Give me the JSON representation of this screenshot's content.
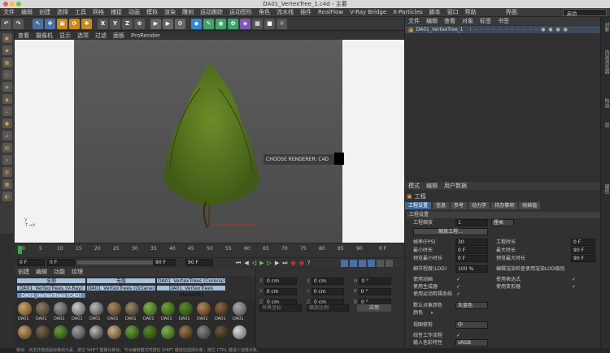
{
  "window": {
    "title": "DA01_VertexTree_1.c4d - 主要"
  },
  "menubar": {
    "items": [
      "文件",
      "编辑",
      "创建",
      "选择",
      "工具",
      "网格",
      "捕捉",
      "动画",
      "模拟",
      "渲染",
      "雕刻",
      "运动跟踪",
      "运动图形",
      "角色",
      "流水线",
      "插件",
      "RealFlow",
      "V-Ray Bridge",
      "X-Particles",
      "脚本",
      "窗口",
      "帮助"
    ],
    "layout_label": "界面:",
    "layout_value": "启动"
  },
  "viewport": {
    "menu": [
      "查看",
      "摄像机",
      "显示",
      "选项",
      "过滤",
      "面板",
      "ProRender"
    ],
    "overlay_text": "CHOOSE RENDERER: C4D"
  },
  "timeline": {
    "ticks": [
      "0",
      "5",
      "10",
      "15",
      "20",
      "25",
      "30",
      "35",
      "40",
      "45",
      "50",
      "55",
      "60",
      "65",
      "70",
      "75",
      "80",
      "85",
      "90"
    ],
    "end_frame": "0 F"
  },
  "transport": {
    "start": "0 F",
    "current": "0 F",
    "end": "90 F",
    "end2": "90 F"
  },
  "materials": {
    "menu": [
      "创建",
      "编辑",
      "功能",
      "纹理"
    ],
    "tags": [
      "全部",
      "无层",
      "DA01_VertexTrees (Corona)",
      "DA01_VertexTrees (V-Ray)",
      "DA01_VertexTrees (Octane)",
      "DA01_VertexTrees (Redshift)",
      "DA01_VertexTrees (C4D)"
    ],
    "thumb_labels": [
      "DA01",
      "DA01",
      "DA01",
      "DA01",
      "DA01",
      "DA01",
      "DA01",
      "DA01",
      "DA01",
      "DA01",
      "DA01",
      "DA01",
      "DA01"
    ]
  },
  "coords": {
    "rows": [
      {
        "axis": "X",
        "val": "0 cm",
        "axis2": "X",
        "val2": "0 cm",
        "axis3": "H",
        "val3": "0 °"
      },
      {
        "axis": "Y",
        "val": "0 cm",
        "axis2": "Y",
        "val2": "0 cm",
        "axis3": "P",
        "val3": "0 °"
      },
      {
        "axis": "Z",
        "val": "0 cm",
        "axis2": "Z",
        "val2": "0 cm",
        "axis3": "B",
        "val3": "0 °"
      }
    ],
    "mode1": "世界坐标",
    "mode2": "缩放比例",
    "apply": "应用"
  },
  "objects": {
    "menu": [
      "文件",
      "编辑",
      "查看",
      "对象",
      "标签",
      "书签"
    ],
    "row_name": "DA01_VertexTree_1"
  },
  "attributes": {
    "menu": [
      "模式",
      "编辑",
      "用户数据"
    ],
    "heading": "工程",
    "tabs": [
      "工程设置",
      "信息",
      "参考",
      "动力学",
      "待办事项",
      "帧插值"
    ],
    "section": "工程设置",
    "scale_label": "工程缩放",
    "scale_value": "1",
    "scale_unit": "厘米",
    "scale_button": "缩放工程...",
    "fps_label": "帧率(FPS)",
    "fps_value": "30",
    "project_time_label": "工程时长",
    "project_time_value": "0 F",
    "min_time_label": "最小时长",
    "min_time_value": "0 F",
    "max_time_label": "最大时长",
    "max_time_value": "90 F",
    "preview_min_label": "预览最小时长",
    "preview_min_value": "0 F",
    "preview_max_label": "预览最大时长",
    "preview_max_value": "90 F",
    "lod_label": "细节程度(LOD)",
    "lod_value": "100 %",
    "lod_render_label": "编辑渲染检查使用渲染LOD级别",
    "use_anim_label": "使用动画",
    "use_expr_label": "使用表达式",
    "use_gen_label": "使用生成器",
    "use_deform_label": "使用变形器",
    "use_motion_label": "使用运动剪辑系统",
    "default_color_label": "默认对象颜色",
    "default_color_value": "灰蓝色",
    "color_label": "颜色",
    "view_label": "视图修剪",
    "view_value": "中",
    "linear_label": "线性工作流程",
    "input_color_label": "输入色彩特性",
    "input_color_value": "sRGB"
  },
  "status": "移动：点击并拖动鼠标移动元素。按住 SHIFT 键量化移动；节点编辑模式时按住 SHIFT 键增加选择对象；按住 CTRL 键减少选择对象。",
  "right_edge_tabs": [
    "对象",
    "内容浏览器",
    "构造",
    "层",
    "属性"
  ],
  "colors": {
    "accent": "#3f6796",
    "tree": "#5a7a1e"
  }
}
